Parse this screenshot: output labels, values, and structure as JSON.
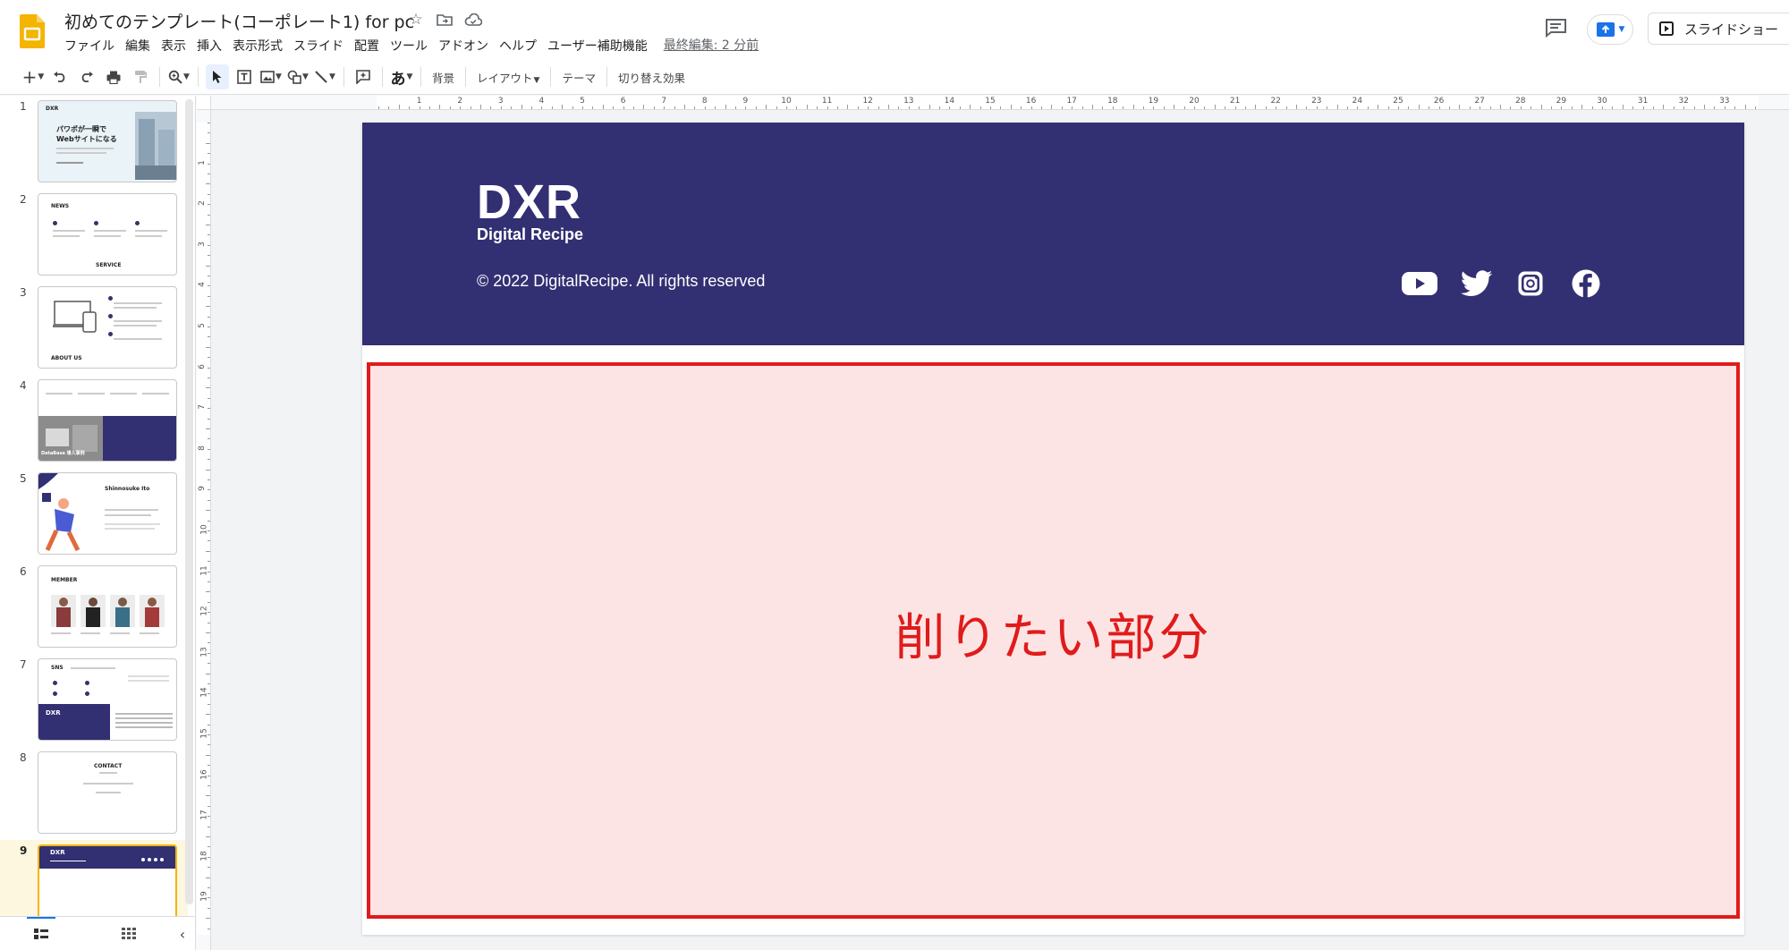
{
  "app": {
    "doc_title": "初めてのテンプレート(コーポレート1) for pc",
    "last_edit": "最終編集: 2 分前",
    "present_label": "スライドショー"
  },
  "menu": [
    "ファイル",
    "編集",
    "表示",
    "挿入",
    "表示形式",
    "スライド",
    "配置",
    "ツール",
    "アドオン",
    "ヘルプ",
    "ユーザー補助機能"
  ],
  "toolbar": {
    "ime_label": "あ",
    "background_label": "背景",
    "layout_label": "レイアウト",
    "theme_label": "テーマ",
    "transition_label": "切り替え効果"
  },
  "filmstrip": {
    "selected_index": 9,
    "slides": [
      {
        "num": "1",
        "title": "パワポが一瞬で",
        "title2": "Webサイトになる",
        "brand": "DXR"
      },
      {
        "num": "2",
        "title": "NEWS",
        "title2": "SERVICE"
      },
      {
        "num": "3",
        "title": "ABOUT US"
      },
      {
        "num": "4",
        "title": "DataBase 導入事例"
      },
      {
        "num": "5",
        "title": "Shinnosuke Ito"
      },
      {
        "num": "6",
        "title": "MEMBER"
      },
      {
        "num": "7",
        "title": "SNS",
        "brand": "DXR"
      },
      {
        "num": "8",
        "title": "CONTACT"
      },
      {
        "num": "9",
        "brand": "DXR"
      }
    ]
  },
  "ruler": {
    "horizontal": [
      "1",
      "2",
      "3",
      "4",
      "5",
      "6",
      "7",
      "8",
      "9",
      "10",
      "11",
      "12",
      "13",
      "14",
      "15",
      "16",
      "17",
      "18",
      "19",
      "20",
      "21",
      "22",
      "23",
      "24",
      "25",
      "26",
      "27",
      "28",
      "29",
      "30",
      "31",
      "32",
      "33"
    ],
    "vertical": [
      "1",
      "2",
      "3",
      "4",
      "5",
      "6",
      "7",
      "8",
      "9",
      "10",
      "11",
      "12",
      "13",
      "14",
      "15",
      "16",
      "17",
      "18",
      "19"
    ]
  },
  "slide": {
    "logo": "DXR",
    "logo_sub": "Digital Recipe",
    "copyright": "© 2022 DigitalRecipe. All rights reserved",
    "social_icons": [
      "youtube-icon",
      "twitter-icon",
      "instagram-icon",
      "facebook-icon"
    ],
    "annotation_label": "削りたい部分",
    "colors": {
      "band": "#332f73",
      "annotation": "#e01b1b",
      "annotation_fill": "#fde4e4"
    }
  }
}
